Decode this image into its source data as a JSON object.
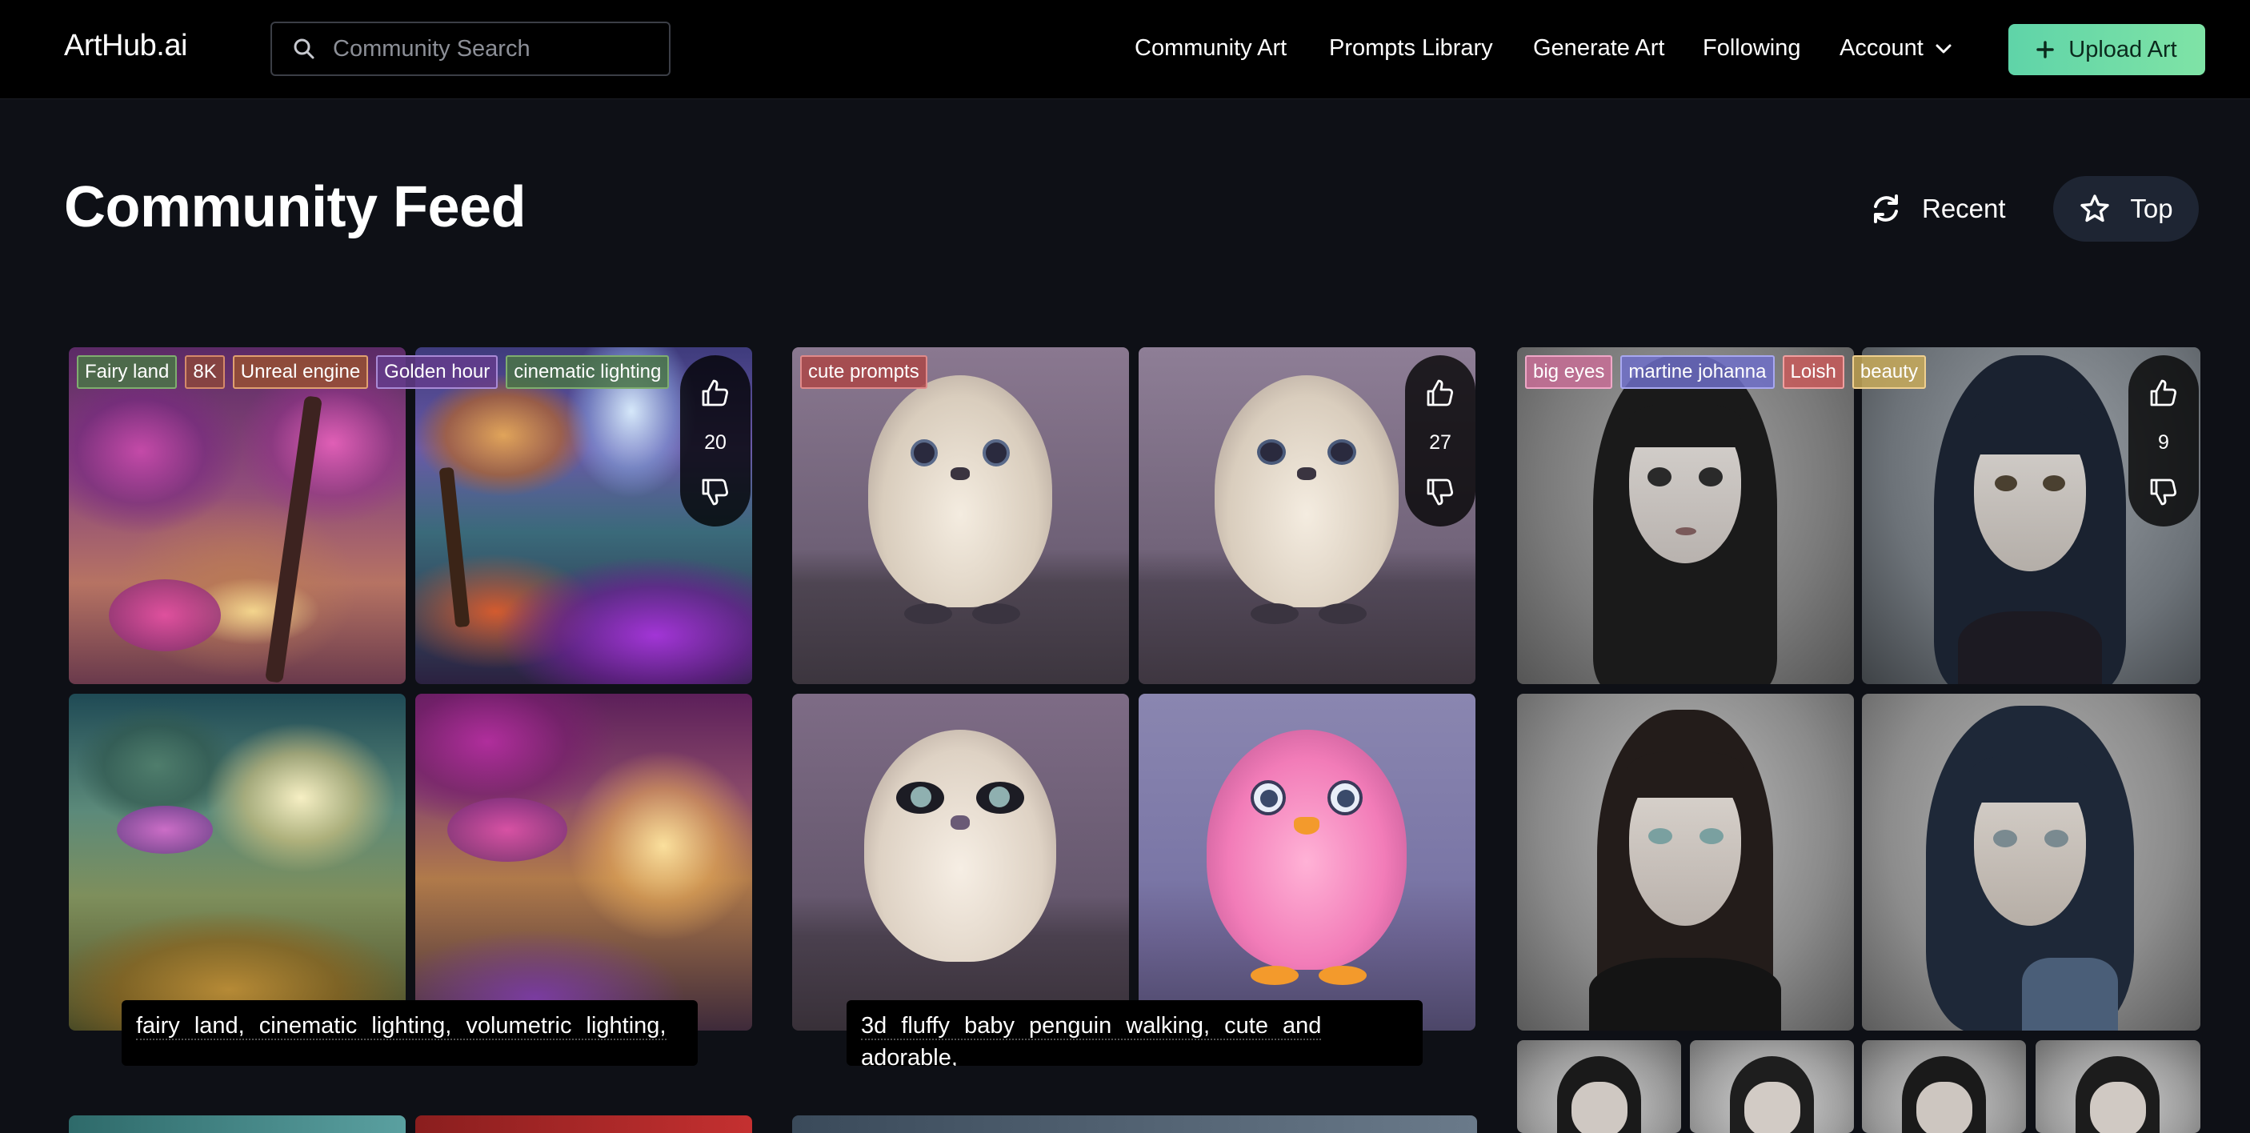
{
  "brand": "ArtHub.ai",
  "search": {
    "placeholder": "Community Search"
  },
  "nav": {
    "community_art": "Community Art",
    "prompts_library": "Prompts Library",
    "generate_art": "Generate Art",
    "following": "Following",
    "account": "Account",
    "upload": "Upload Art"
  },
  "page": {
    "title": "Community Feed",
    "sort_recent": "Recent",
    "sort_top": "Top"
  },
  "cards": [
    {
      "tags": [
        "Fairy land",
        "8K",
        "Unreal engine",
        "Golden hour",
        "cinematic lighting"
      ],
      "votes": "20",
      "caption": "fairy land, cinematic lighting, volumetric lighting,"
    },
    {
      "tags": [
        "cute prompts"
      ],
      "votes": "27",
      "caption": "3d fluffy baby penguin walking, cute and adorable,"
    },
    {
      "tags": [
        "big eyes",
        "martine johanna",
        "Loish",
        "beauty"
      ],
      "votes": "9"
    }
  ],
  "colors": {
    "background": "#0e1016",
    "navbar": "#000000",
    "upload_gradient_start": "#5fd4a8",
    "upload_gradient_end": "#7fe3a6",
    "top_pill": "#1e2533"
  },
  "icons": {
    "search": "search-icon",
    "account_chevron": "chevron-down-icon",
    "upload_plus": "plus-icon",
    "recent": "refresh-icon",
    "top": "star-icon",
    "upvote": "thumbs-up-icon",
    "downvote": "thumbs-down-icon"
  }
}
